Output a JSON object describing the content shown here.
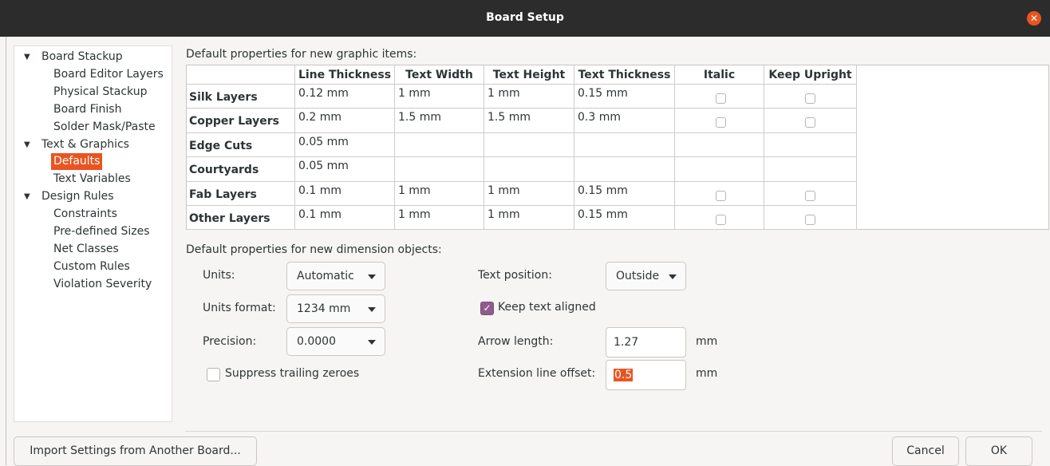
{
  "window": {
    "title": "Board Setup"
  },
  "tree": [
    {
      "label": "Board Stackup",
      "level": 0,
      "expanded": true
    },
    {
      "label": "Board Editor Layers",
      "level": 1
    },
    {
      "label": "Physical Stackup",
      "level": 1
    },
    {
      "label": "Board Finish",
      "level": 1
    },
    {
      "label": "Solder Mask/Paste",
      "level": 1
    },
    {
      "label": "Text & Graphics",
      "level": 0,
      "expanded": true
    },
    {
      "label": "Defaults",
      "level": 1,
      "selected": true
    },
    {
      "label": "Text Variables",
      "level": 1
    },
    {
      "label": "Design Rules",
      "level": 0,
      "expanded": true
    },
    {
      "label": "Constraints",
      "level": 1
    },
    {
      "label": "Pre-defined Sizes",
      "level": 1
    },
    {
      "label": "Net Classes",
      "level": 1
    },
    {
      "label": "Custom Rules",
      "level": 1
    },
    {
      "label": "Violation Severity",
      "level": 1
    }
  ],
  "graphics": {
    "heading": "Default properties for new graphic items:",
    "columns": [
      "Line Thickness",
      "Text Width",
      "Text Height",
      "Text Thickness",
      "Italic",
      "Keep Upright"
    ],
    "rows": [
      {
        "name": "Silk Layers",
        "line": "0.12 mm",
        "width": "1 mm",
        "height": "1 mm",
        "thick": "0.15 mm",
        "checks": true
      },
      {
        "name": "Copper Layers",
        "line": "0.2 mm",
        "width": "1.5 mm",
        "height": "1.5 mm",
        "thick": "0.3 mm",
        "checks": true
      },
      {
        "name": "Edge Cuts",
        "line": "0.05 mm",
        "width": "",
        "height": "",
        "thick": "",
        "checks": false
      },
      {
        "name": "Courtyards",
        "line": "0.05 mm",
        "width": "",
        "height": "",
        "thick": "",
        "checks": false
      },
      {
        "name": "Fab Layers",
        "line": "0.1 mm",
        "width": "1 mm",
        "height": "1 mm",
        "thick": "0.15 mm",
        "checks": true
      },
      {
        "name": "Other Layers",
        "line": "0.1 mm",
        "width": "1 mm",
        "height": "1 mm",
        "thick": "0.15 mm",
        "checks": true
      }
    ]
  },
  "dimensions": {
    "heading": "Default properties for new dimension objects:",
    "units_label": "Units:",
    "units_value": "Automatic",
    "units_format_label": "Units format:",
    "units_format_value": "1234 mm",
    "precision_label": "Precision:",
    "precision_value": "0.0000",
    "suppress_label": "Suppress trailing zeroes",
    "suppress_checked": false,
    "text_position_label": "Text position:",
    "text_position_value": "Outside",
    "keep_aligned_label": "Keep text aligned",
    "keep_aligned_checked": true,
    "arrow_length_label": "Arrow length:",
    "arrow_length_value": "1.27",
    "arrow_length_unit": "mm",
    "extension_offset_label": "Extension line offset:",
    "extension_offset_value": "0.5",
    "extension_offset_unit": "mm"
  },
  "footer": {
    "import_label": "Import Settings from Another Board...",
    "cancel_label": "Cancel",
    "ok_label": "OK"
  }
}
